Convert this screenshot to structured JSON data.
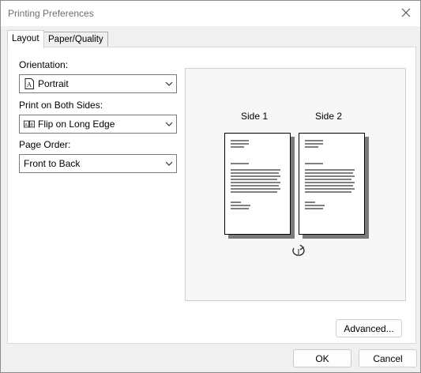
{
  "window": {
    "title": "Printing Preferences"
  },
  "tabs": [
    {
      "label": "Layout",
      "active": true
    },
    {
      "label": "Paper/Quality",
      "active": false
    }
  ],
  "layout": {
    "orientation": {
      "label": "Orientation:",
      "value": "Portrait",
      "icon": "portrait-page-icon"
    },
    "duplex": {
      "label": "Print on Both Sides:",
      "value": "Flip on Long Edge",
      "icon": "book-flip-icon"
    },
    "page_order": {
      "label": "Page Order:",
      "value": "Front to Back"
    }
  },
  "preview": {
    "side1_label": "Side 1",
    "side2_label": "Side 2",
    "flip_icon": "flip-arrow-icon"
  },
  "buttons": {
    "advanced": "Advanced...",
    "ok": "OK",
    "cancel": "Cancel"
  },
  "colors": {
    "window_bg": "#f0f0f0",
    "panel_bg": "#ffffff",
    "preview_bg": "#f7f7f7",
    "page_shadow": "#7a7a7a"
  }
}
